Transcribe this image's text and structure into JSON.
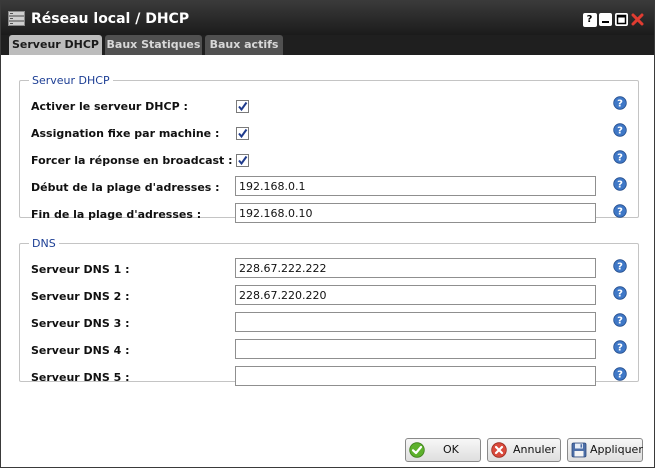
{
  "window": {
    "title": "Réseau local / DHCP",
    "controls": {
      "help": "?",
      "minimize": "minimize",
      "maximize": "maximize",
      "close": "close"
    }
  },
  "tabs": [
    {
      "label": "Serveur DHCP",
      "active": true
    },
    {
      "label": "Baux Statiques",
      "active": false
    },
    {
      "label": "Baux actifs",
      "active": false
    }
  ],
  "dhcp_section": {
    "legend": "Serveur DHCP",
    "fields": [
      {
        "label": "Activer le serveur DHCP :",
        "type": "checkbox",
        "checked": true
      },
      {
        "label": "Assignation fixe par machine :",
        "type": "checkbox",
        "checked": true
      },
      {
        "label": "Forcer la réponse en broadcast :",
        "type": "checkbox",
        "checked": true
      },
      {
        "label": "Début de la plage d'adresses :",
        "type": "text",
        "value": "192.168.0.1"
      },
      {
        "label": "Fin de la plage d'adresses :",
        "type": "text",
        "value": "192.168.0.10"
      }
    ]
  },
  "dns_section": {
    "legend": "DNS",
    "fields": [
      {
        "label": "Serveur DNS 1 :",
        "type": "text",
        "value": "228.67.222.222"
      },
      {
        "label": "Serveur DNS 2 :",
        "type": "text",
        "value": "228.67.220.220"
      },
      {
        "label": "Serveur DNS 3 :",
        "type": "text",
        "value": ""
      },
      {
        "label": "Serveur DNS 4 :",
        "type": "text",
        "value": ""
      },
      {
        "label": "Serveur DNS 5 :",
        "type": "text",
        "value": ""
      }
    ]
  },
  "buttons": {
    "ok": "OK",
    "cancel": "Annuler",
    "apply": "Appliquer"
  },
  "icons": {
    "help": "help-question-icon",
    "ok": "check-circle-icon",
    "cancel": "cancel-circle-icon",
    "apply": "floppy-disk-icon"
  },
  "colors": {
    "titlebar": "#262626",
    "legend_text": "#1c3e94",
    "help_icon": "#3f78c7",
    "ok_icon": "#5db12c",
    "cancel_icon": "#d94a3c",
    "close_icon": "#e03c31"
  }
}
